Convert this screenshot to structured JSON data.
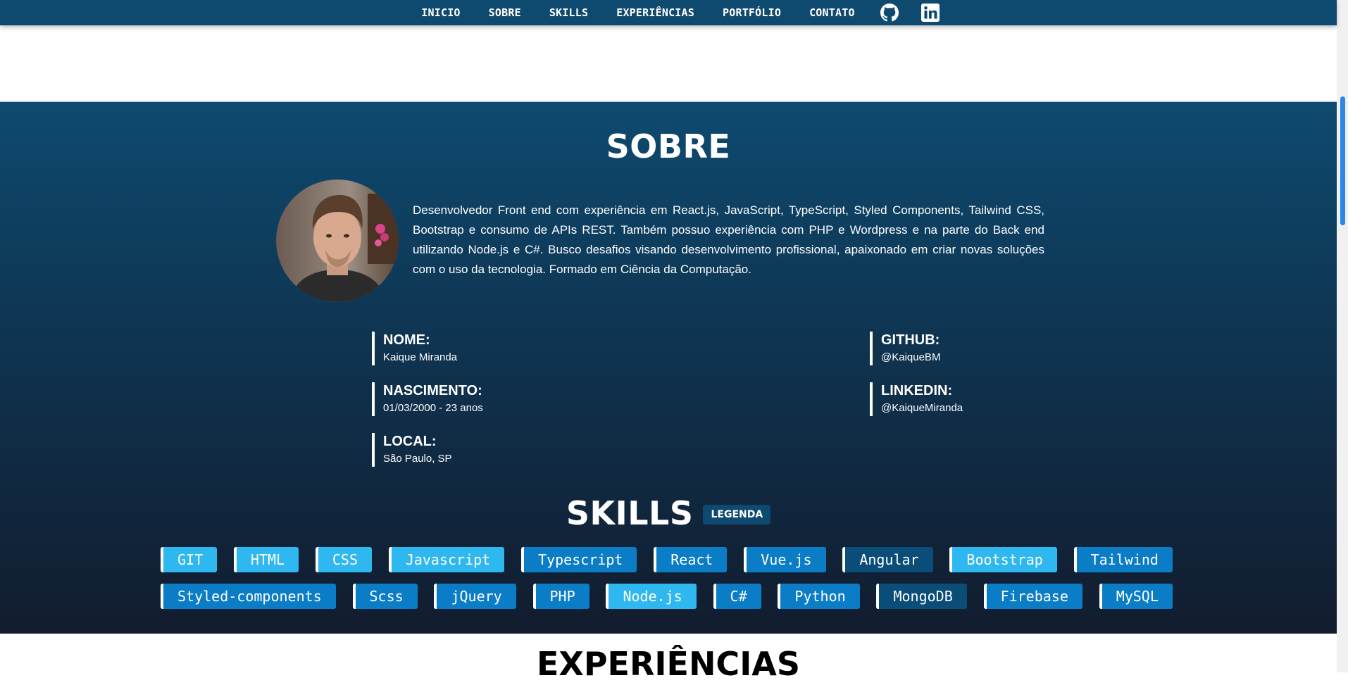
{
  "nav": {
    "links": [
      "INICIO",
      "SOBRE",
      "SKILLS",
      "EXPERIÊNCIAS",
      "PORTFÓLIO",
      "CONTATO"
    ],
    "icons": [
      "github-icon",
      "linkedin-icon"
    ]
  },
  "sobre": {
    "title": "SOBRE",
    "bio": "Desenvolvedor Front end com experiência em React.js, JavaScript, TypeScript, Styled Components, Tailwind CSS, Bootstrap e consumo de APIs REST. Também possuo experiência com PHP e Wordpress e na parte do Back end utilizando Node.js e C#. Busco desafios visando desenvolvimento profissional, apaixonado em criar novas soluções com o uso da tecnologia. Formado em Ciência da Computação.",
    "info": {
      "nome_label": "NOME:",
      "nome_value": "Kaique Miranda",
      "nascimento_label": "NASCIMENTO:",
      "nascimento_value": "01/03/2000 - 23 anos",
      "local_label": "LOCAL:",
      "local_value": "São Paulo, SP",
      "github_label": "GITHUB:",
      "github_value": "@KaiqueBM",
      "linkedin_label": "LINKEDIN:",
      "linkedin_value": "@KaiqueMiranda"
    }
  },
  "skills": {
    "title": "SKILLS",
    "legend": "LEGENDA",
    "row1": [
      {
        "name": "GIT",
        "level": "a"
      },
      {
        "name": "HTML",
        "level": "a"
      },
      {
        "name": "CSS",
        "level": "a"
      },
      {
        "name": "Javascript",
        "level": "a"
      },
      {
        "name": "Typescript",
        "level": "b"
      },
      {
        "name": "React",
        "level": "b"
      },
      {
        "name": "Vue.js",
        "level": "b"
      },
      {
        "name": "Angular",
        "level": "c"
      },
      {
        "name": "Bootstrap",
        "level": "a"
      },
      {
        "name": "Tailwind",
        "level": "b"
      }
    ],
    "row2": [
      {
        "name": "Styled-components",
        "level": "b"
      },
      {
        "name": "Scss",
        "level": "b"
      },
      {
        "name": "jQuery",
        "level": "b"
      },
      {
        "name": "PHP",
        "level": "b"
      },
      {
        "name": "Node.js",
        "level": "a"
      },
      {
        "name": "C#",
        "level": "b"
      },
      {
        "name": "Python",
        "level": "b"
      },
      {
        "name": "MongoDB",
        "level": "c"
      },
      {
        "name": "Firebase",
        "level": "b"
      },
      {
        "name": "MySQL",
        "level": "b"
      }
    ],
    "level_colors": {
      "a": "#2fb7ef",
      "b": "#0a7dc6",
      "c": "#0b4d79"
    }
  },
  "next_section": {
    "title": "EXPERIÊNCIAS"
  },
  "colors": {
    "navbar": "#0e4a6f",
    "section_top": "#0e4a6f",
    "section_bottom": "#121c2e",
    "scroll_thumb": "#2b87e8"
  }
}
